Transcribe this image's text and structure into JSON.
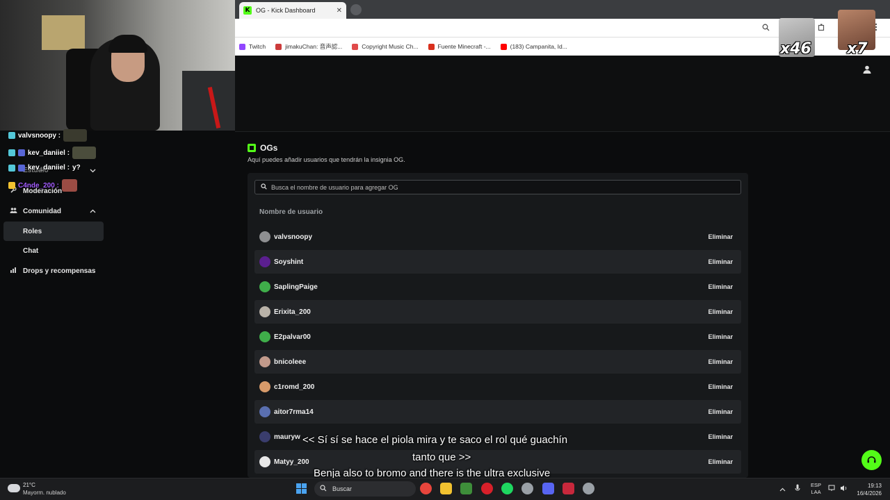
{
  "browser": {
    "tab_title": "OG - Kick Dashboard",
    "tab_logo": "K",
    "tab_close": "✕",
    "bookmarks": [
      {
        "label": "Twitch",
        "color": "#9146ff"
      },
      {
        "label": "jimakuChan: 音声認...",
        "color": "#cc3b3b"
      },
      {
        "label": "Copyright Music Ch...",
        "color": "#e04a4a"
      },
      {
        "label": "Fuente Minecraft -...",
        "color": "#d9301e"
      },
      {
        "label": "(183) Campanita, Id...",
        "color": "#ff0000"
      }
    ]
  },
  "overlay": {
    "cat_count": "x46",
    "face_count": "x7"
  },
  "chat": [
    {
      "user": "valvsnoopy :",
      "color": "#ffffff",
      "icon_color": "#53c7d8"
    },
    {
      "user": "kev_daniiel :",
      "color": "#ffffff",
      "icon_color": "#53c7d8"
    },
    {
      "user": "kev_daniiel :",
      "color": "#ffffff",
      "message": "y?",
      "icon_color": "#53c7d8"
    },
    {
      "user": "C4nde_200 :",
      "color": "#a35cff",
      "icon_color": "#f2c230"
    }
  ],
  "sidebar": {
    "estudio": "Estudio",
    "moderacion": "Moderación",
    "comunidad": "Comunidad",
    "roles": "Roles",
    "chat": "Chat",
    "drops": "Drops y recompensas"
  },
  "main": {
    "title": "OGs",
    "subtitle": "Aquí puedes añadir usuarios que tendrán la insignia OG.",
    "search_placeholder": "Busca el nombre de usuario para agregar OG",
    "column_header": "Nombre de usuario",
    "delete_label": "Eliminar",
    "users": [
      {
        "name": "valvsnoopy",
        "avatar": "#8e8f91"
      },
      {
        "name": "Soyshint",
        "avatar": "#5b1f8f"
      },
      {
        "name": "SaplingPaige",
        "avatar": "#3fae4a"
      },
      {
        "name": "Erixita_200",
        "avatar": "#b9b2a8"
      },
      {
        "name": "E2palvar00",
        "avatar": "#3fae4a"
      },
      {
        "name": "bnicoleee",
        "avatar": "#c29a8b"
      },
      {
        "name": "c1romd_200",
        "avatar": "#d79a6a"
      },
      {
        "name": "aitor7rma14",
        "avatar": "#5a6fb0"
      },
      {
        "name": "mauryw",
        "avatar": "#3a3d6d"
      },
      {
        "name": "Matyy_200",
        "avatar": "#e8e8e8"
      }
    ]
  },
  "subtitles": {
    "line1": "<< Sí sí se hace el piola mira y te saco el rol qué guachín",
    "line2": "tanto que >>",
    "line3": "Benja also to bromo and there is the ultra exclusive"
  },
  "taskbar": {
    "temp": "21°C",
    "weather": "Mayorm. nublado",
    "search": "Buscar",
    "lang1": "ESP",
    "lang2": "LAA",
    "time": "19:13",
    "date": "16/4/2026",
    "apps": [
      {
        "name": "chrome",
        "color": "#e8453c"
      },
      {
        "name": "files",
        "color": "#f2c230"
      },
      {
        "name": "minecraft",
        "color": "#3e8e3a"
      },
      {
        "name": "opera",
        "color": "#d8202a"
      },
      {
        "name": "spotify",
        "color": "#1ed760"
      },
      {
        "name": "steam",
        "color": "#9aa0a6"
      },
      {
        "name": "discord",
        "color": "#5865f2"
      },
      {
        "name": "app",
        "color": "#c8283c"
      },
      {
        "name": "settings",
        "color": "#9aa0a6"
      }
    ]
  }
}
